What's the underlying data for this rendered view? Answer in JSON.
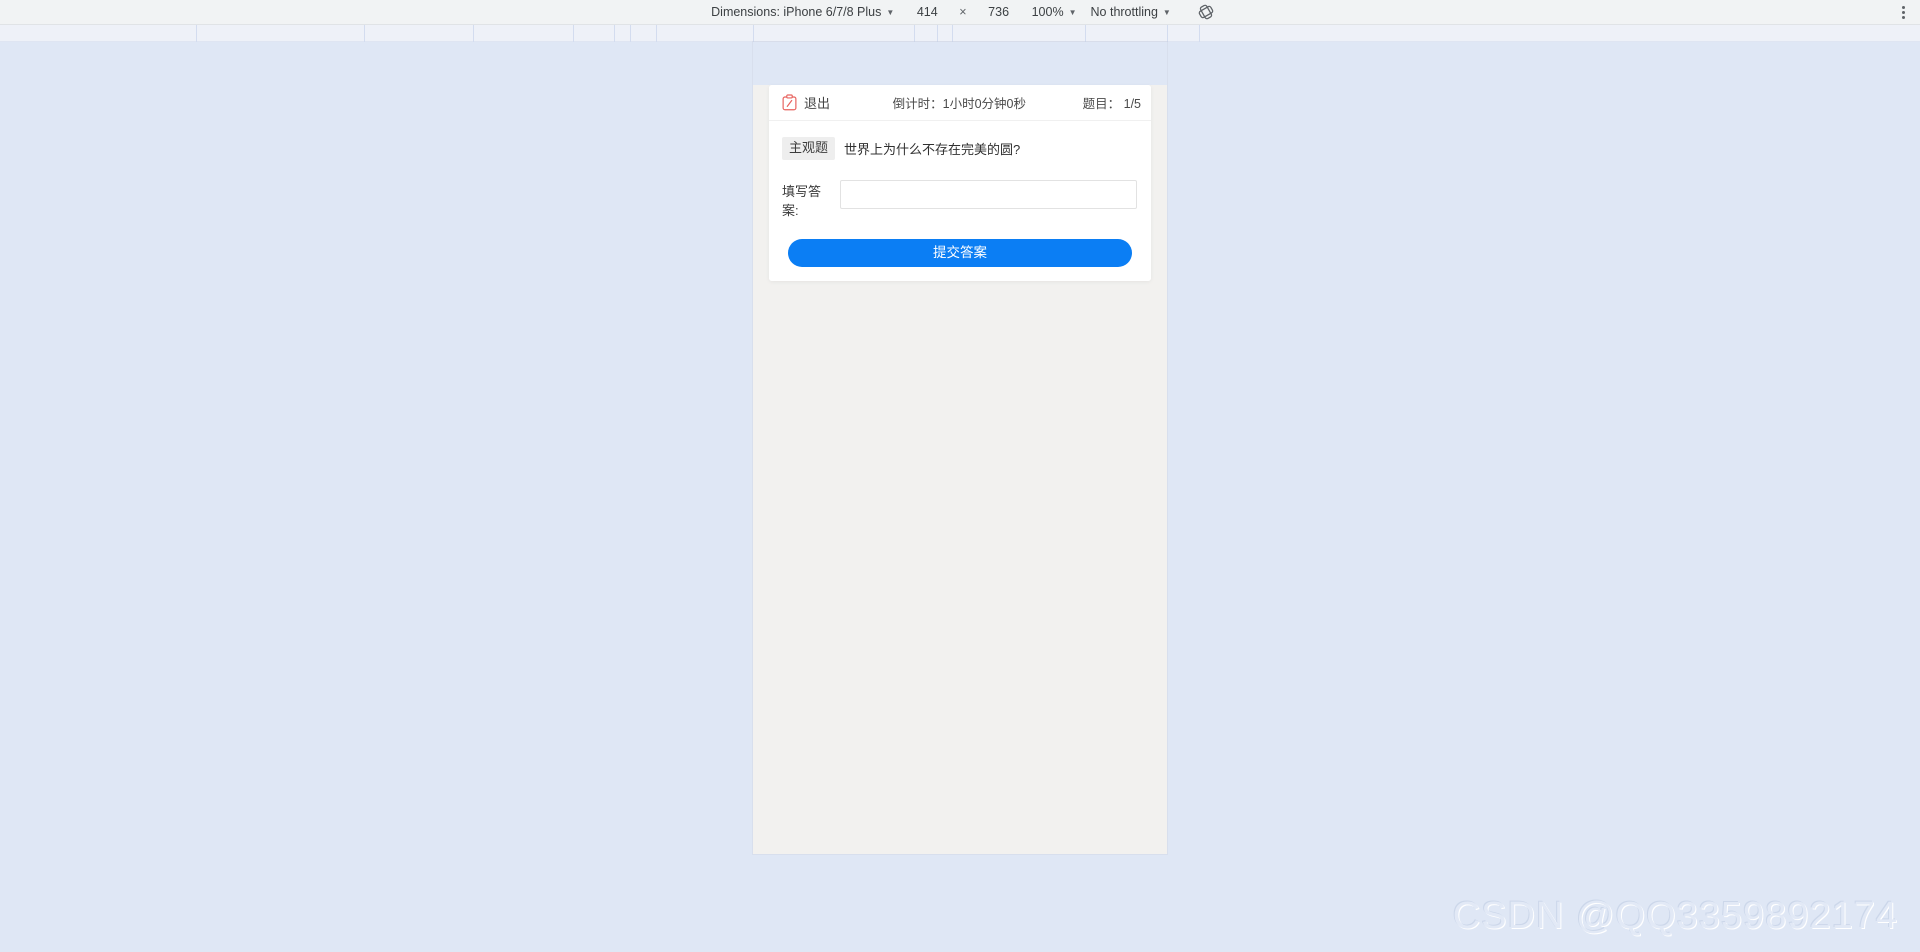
{
  "devtools": {
    "dimensions_label": "Dimensions: iPhone 6/7/8 Plus",
    "width_value": "414",
    "times_symbol": "×",
    "height_value": "736",
    "zoom_label": "100%",
    "throttling_label": "No throttling",
    "rotate_icon": "rotate-icon",
    "more_icon": "more-vertical-icon",
    "caret": "▼"
  },
  "quiz": {
    "header": {
      "exit_icon": "clipboard-pencil-icon",
      "exit_label": "退出",
      "countdown_label": "倒计时：1小时0分钟0秒",
      "question_index_label": "题目： 1/5"
    },
    "question": {
      "type_tag": "主观题",
      "text": "世界上为什么不存在完美的圆?"
    },
    "answer": {
      "label": "填写答案:",
      "value": "",
      "placeholder": ""
    },
    "submit_label": "提交答案"
  },
  "watermark": {
    "text": "CSDN @QQ3359892174"
  },
  "colors": {
    "page_background": "#dfe7f5",
    "viewport_background": "#f2f1ef",
    "toolbar_background": "#f1f3f4",
    "accent_blue": "#0b7ef4",
    "tag_background": "#eeeeee",
    "exit_icon_red": "#e8635f"
  }
}
